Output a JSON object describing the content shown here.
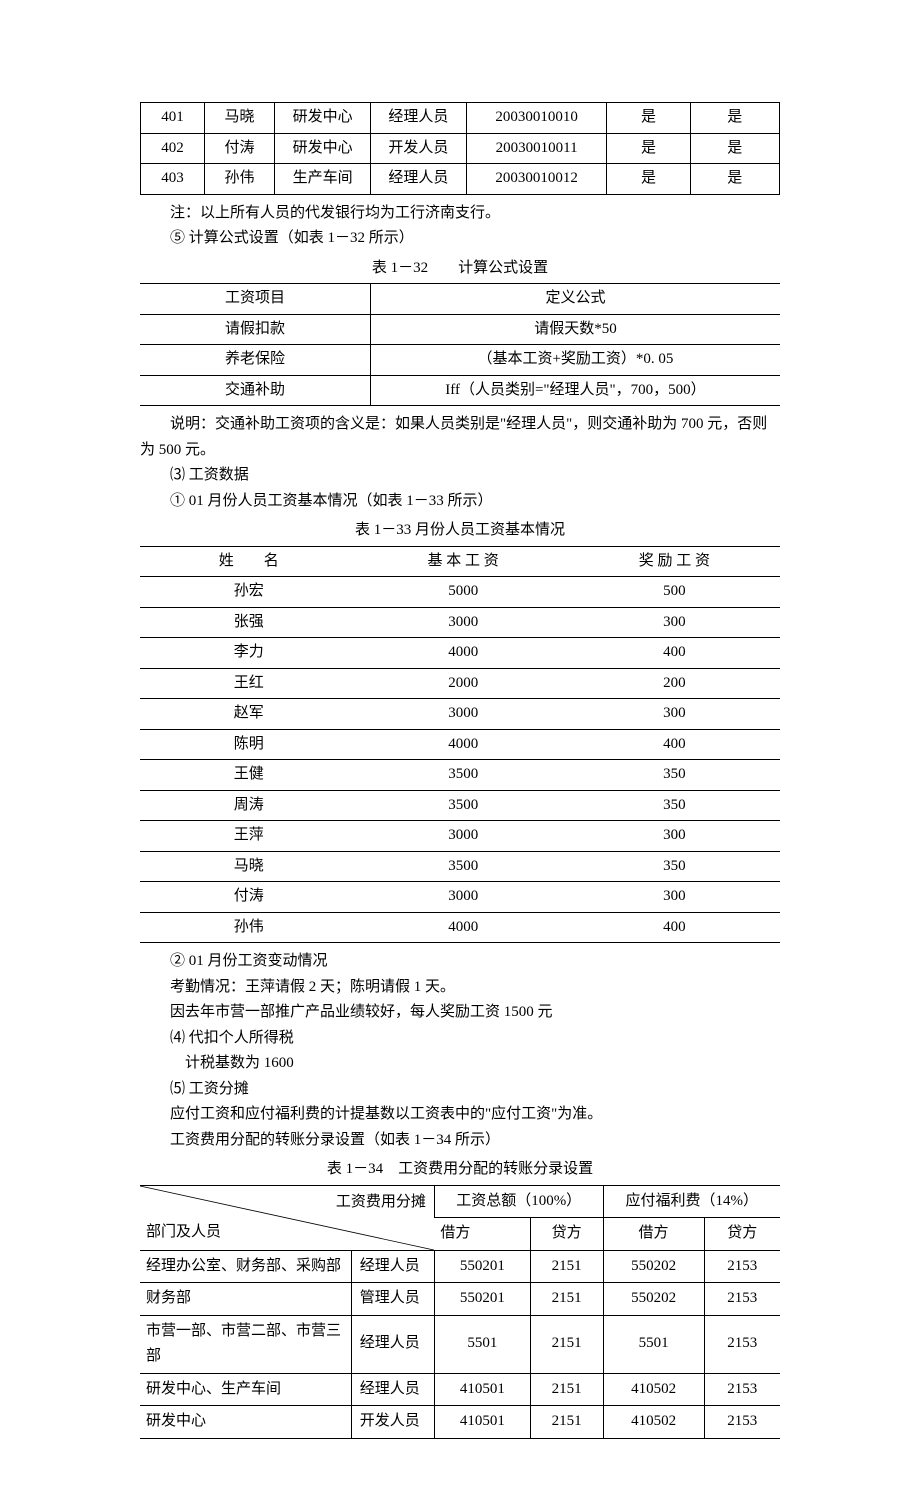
{
  "table1": {
    "rows": [
      {
        "c1": "401",
        "c2": "马晓",
        "c3": "研发中心",
        "c4": "经理人员",
        "c5": "20030010010",
        "c6": "是",
        "c7": "是"
      },
      {
        "c1": "402",
        "c2": "付涛",
        "c3": "研发中心",
        "c4": "开发人员",
        "c5": "20030010011",
        "c6": "是",
        "c7": "是"
      },
      {
        "c1": "403",
        "c2": "孙伟",
        "c3": "生产车间",
        "c4": "经理人员",
        "c5": "20030010012",
        "c6": "是",
        "c7": "是"
      }
    ]
  },
  "text": {
    "note1": "注：以上所有人员的代发银行均为工行济南支行。",
    "item5": "⑤ 计算公式设置（如表 1－32 所示）",
    "caption32": "表 1－32　　计算公式设置",
    "note2": "说明：交通补助工资项的含义是：如果人员类别是\"经理人员\"，则交通补助为 700 元，否则为 500 元。",
    "h3": "⑶ 工资数据",
    "item6": "① 01 月份人员工资基本情况（如表 1－33 所示）",
    "caption33": "表 1－33  月份人员工资基本情况",
    "item7": "② 01 月份工资变动情况",
    "att": "考勤情况：王萍请假 2 天；陈明请假 1 天。",
    "bonus": "因去年市营一部推广产品业绩较好，每人奖励工资 1500 元",
    "h4": "⑷ 代扣个人所得税",
    "taxbase": "计税基数为 1600",
    "h5": "⑸ 工资分摊",
    "alloc1": "应付工资和应付福利费的计提基数以工资表中的\"应付工资\"为准。",
    "alloc2": "工资费用分配的转账分录设置（如表 1－34 所示）",
    "caption34": "表 1－34　工资费用分配的转账分录设置"
  },
  "table32": {
    "headers": {
      "h1": "工资项目",
      "h2": "定义公式"
    },
    "rows": [
      {
        "c1": "请假扣款",
        "c2": "请假天数*50"
      },
      {
        "c1": "养老保险",
        "c2": "（基本工资+奖励工资）*0. 05"
      },
      {
        "c1": "交通补助",
        "c2": "Iff（人员类别=\"经理人员\"，700，500）"
      }
    ]
  },
  "table33": {
    "headers": {
      "h1": "姓　　名",
      "h2": "基 本 工 资",
      "h3": "奖 励 工 资"
    },
    "rows": [
      {
        "c1": "孙宏",
        "c2": "5000",
        "c3": "500"
      },
      {
        "c1": "张强",
        "c2": "3000",
        "c3": "300"
      },
      {
        "c1": "李力",
        "c2": "4000",
        "c3": "400"
      },
      {
        "c1": "王红",
        "c2": "2000",
        "c3": "200"
      },
      {
        "c1": "赵军",
        "c2": "3000",
        "c3": "300"
      },
      {
        "c1": "陈明",
        "c2": "4000",
        "c3": "400"
      },
      {
        "c1": "王健",
        "c2": "3500",
        "c3": "350"
      },
      {
        "c1": "周涛",
        "c2": "3500",
        "c3": "350"
      },
      {
        "c1": "王萍",
        "c2": "3000",
        "c3": "300"
      },
      {
        "c1": "马晓",
        "c2": "3500",
        "c3": "350"
      },
      {
        "c1": "付涛",
        "c2": "3000",
        "c3": "300"
      },
      {
        "c1": "孙伟",
        "c2": "4000",
        "c3": "400"
      }
    ]
  },
  "table34": {
    "diag_top": "工资费用分摊",
    "diag_bottom": "部门及人员",
    "group1": "工资总额（100%）",
    "group2": "应付福利费（14%）",
    "sub": {
      "s1": "借方",
      "s2": "贷方",
      "s3": "借方",
      "s4": "贷方"
    },
    "rows": [
      {
        "c1": "经理办公室、财务部、采购部",
        "c2": "经理人员",
        "c3": "550201",
        "c4": "2151",
        "c5": "550202",
        "c6": "2153"
      },
      {
        "c1": "财务部",
        "c2": "管理人员",
        "c3": "550201",
        "c4": "2151",
        "c5": "550202",
        "c6": "2153"
      },
      {
        "c1": "市营一部、市营二部、市营三部",
        "c2": "经理人员",
        "c3": "5501",
        "c4": "2151",
        "c5": "5501",
        "c6": "2153"
      },
      {
        "c1": "研发中心、生产车间",
        "c2": "经理人员",
        "c3": "410501",
        "c4": "2151",
        "c5": "410502",
        "c6": "2153"
      },
      {
        "c1": "研发中心",
        "c2": "开发人员",
        "c3": "410501",
        "c4": "2151",
        "c5": "410502",
        "c6": "2153"
      }
    ]
  }
}
